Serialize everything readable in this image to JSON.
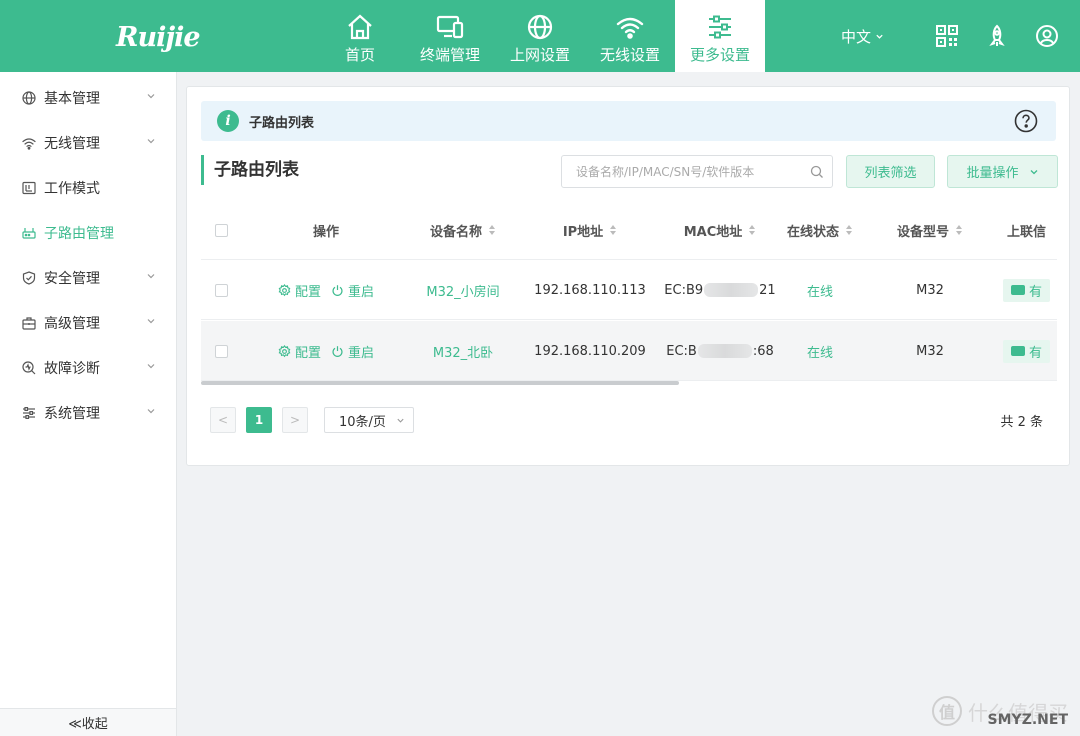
{
  "header": {
    "logo": "Ruijie",
    "nav": [
      {
        "label": "首页",
        "icon": "home-icon"
      },
      {
        "label": "终端管理",
        "icon": "devices-icon"
      },
      {
        "label": "上网设置",
        "icon": "globe-icon"
      },
      {
        "label": "无线设置",
        "icon": "wifi-icon"
      },
      {
        "label": "更多设置",
        "icon": "sliders-icon",
        "active": true
      }
    ],
    "language": "中文",
    "right_icons": [
      "qrcode-icon",
      "rocket-icon",
      "user-icon"
    ]
  },
  "sidebar": {
    "items": [
      {
        "label": "基本管理",
        "icon": "globe-icon",
        "has_children": true
      },
      {
        "label": "无线管理",
        "icon": "wifi-icon",
        "has_children": true
      },
      {
        "label": "工作模式",
        "icon": "mode-icon",
        "has_children": false
      },
      {
        "label": "子路由管理",
        "icon": "router-icon",
        "has_children": false,
        "active": true
      },
      {
        "label": "安全管理",
        "icon": "shield-icon",
        "has_children": true
      },
      {
        "label": "高级管理",
        "icon": "toolbox-icon",
        "has_children": true
      },
      {
        "label": "故障诊断",
        "icon": "diagnose-icon",
        "has_children": true
      },
      {
        "label": "系统管理",
        "icon": "settings-icon",
        "has_children": true
      }
    ],
    "collapse_label": "≪收起"
  },
  "main": {
    "banner_title": "子路由列表",
    "section_title": "子路由列表",
    "search_placeholder": "设备名称/IP/MAC/SN号/软件版本",
    "filter_button": "列表筛选",
    "batch_button": "批量操作",
    "table": {
      "columns": [
        "操作",
        "设备名称",
        "IP地址",
        "MAC地址",
        "在线状态",
        "设备型号",
        "上联信"
      ],
      "rows": [
        {
          "config": "配置",
          "restart": "重启",
          "name": "M32_小房间",
          "ip": "192.168.110.113",
          "mac_prefix": "EC:B9",
          "mac_suffix": "21",
          "status": "在线",
          "model": "M32",
          "uplink": "有"
        },
        {
          "config": "配置",
          "restart": "重启",
          "name": "M32_北卧",
          "ip": "192.168.110.209",
          "mac_prefix": "EC:B",
          "mac_suffix": ":68",
          "status": "在线",
          "model": "M32",
          "uplink": "有"
        }
      ]
    },
    "pagination": {
      "prev": "<",
      "current": "1",
      "next": ">",
      "page_size": "10条/页",
      "total": "共 2 条"
    }
  },
  "watermark": {
    "text": "什么值得买",
    "sub": "SMYZ.NET",
    "logo_char": "值"
  },
  "colors": {
    "accent": "#3dbb8f",
    "banner_bg": "#e9f4fb"
  }
}
